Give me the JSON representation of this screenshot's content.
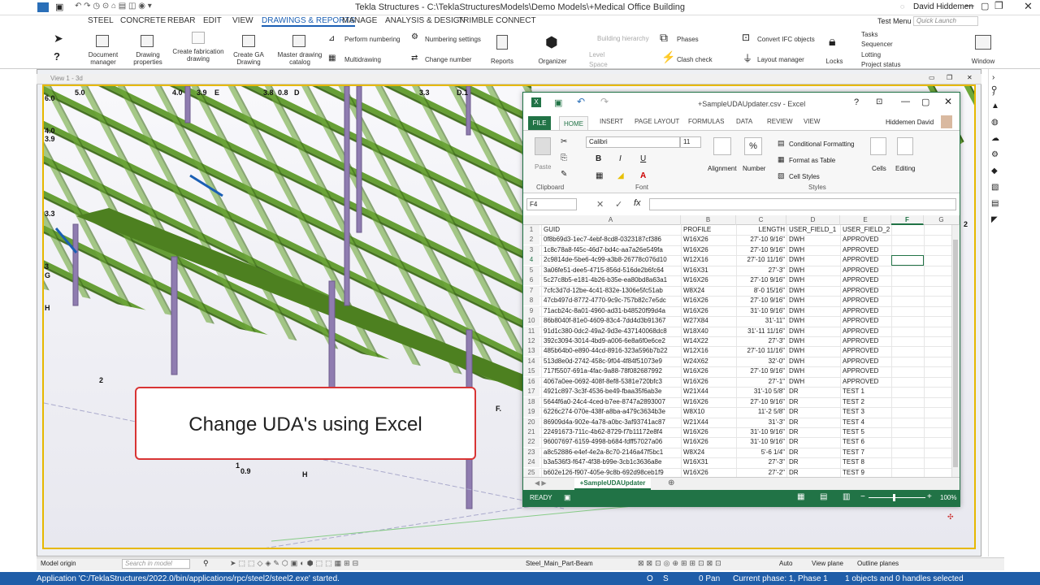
{
  "app": {
    "title": "Tekla Structures - C:\\TeklaStructuresModels\\Demo Models\\+Medical Office Building",
    "user": "David Hiddemen",
    "test_menu": "Test Menu",
    "quick_launch": "Quick Launch"
  },
  "menus": [
    "STEEL",
    "CONCRETE",
    "REBAR",
    "EDIT",
    "VIEW",
    "DRAWINGS & REPORTS",
    "MANAGE",
    "ANALYSIS & DESIGN",
    "TRIMBLE CONNECT"
  ],
  "ribbon": {
    "document_manager": "Document manager",
    "drawing_properties": "Drawing properties",
    "create_fab": "Create fabrication drawing",
    "create_ga": "Create GA Drawing",
    "master_catalog": "Master drawing catalog",
    "perform_numbering": "Perform numbering",
    "numbering_settings": "Numbering settings",
    "multidrawing": "Multidrawing",
    "change_number": "Change number",
    "reports": "Reports",
    "organizer": "Organizer",
    "building_hierarchy": "Building hierarchy",
    "level": "Level",
    "space": "Space",
    "phases": "Phases",
    "clash_check": "Clash check",
    "convert_ifc": "Convert IFC objects",
    "layout_manager": "Layout manager",
    "locks": "Locks",
    "tasks": "Tasks",
    "sequencer": "Sequencer",
    "lotting": "Lotting",
    "project_status": "Project status",
    "window": "Window"
  },
  "view": {
    "title": "View 1 - 3d"
  },
  "grid_labels": {
    "g50": "5.0",
    "g40": "4.0",
    "g39": "3.9",
    "g38": "3.8",
    "g33": "3.3",
    "gd1": "D.1",
    "gE": "E",
    "g60": "6.0",
    "g4": "4.0",
    "g3_9": "3.9",
    "g3_3": "3.3",
    "g3": "3",
    "gG": "G",
    "gH": "H",
    "g2": "2",
    "g10": "1",
    "g09": "0.9",
    "gH2": "H",
    "gF": "F.",
    "g08": "0.8",
    "gD": "D",
    "g2r": "2"
  },
  "callout": {
    "text": "Change UDA's using Excel"
  },
  "excel": {
    "title": "+SampleUDAUpdater.csv - Excel",
    "user": "Hiddemen David",
    "tabs": [
      "FILE",
      "HOME",
      "INSERT",
      "PAGE LAYOUT",
      "FORMULAS",
      "DATA",
      "REVIEW",
      "VIEW"
    ],
    "font": "Calibri",
    "font_size": "11",
    "clipboard": "Clipboard",
    "paste": "Paste",
    "font_group": "Font",
    "alignment": "Alignment",
    "number": "Number",
    "conditional": "Conditional Formatting",
    "format_table": "Format as Table",
    "cell_styles": "Cell Styles",
    "styles": "Styles",
    "cells": "Cells",
    "editing": "Editing",
    "name_box": "F4",
    "fx": "fx",
    "cols": [
      "A",
      "B",
      "C",
      "D",
      "E",
      "F",
      "G"
    ],
    "headers": [
      "GUID",
      "PROFILE",
      "LENGTH",
      "USER_FIELD_1",
      "USER_FIELD_2"
    ],
    "rows": [
      [
        "0f8b69d3-1ec7-4ebf-8cd8-0323187cf386",
        "W16X26",
        "27'-10 9/16\"",
        "DWH",
        "APPROVED"
      ],
      [
        "1c8c78a8-f45c-46d7-bd4c-aa7a26e549fa",
        "W16X26",
        "27'-10 9/16\"",
        "DWH",
        "APPROVED"
      ],
      [
        "2c9814de-5be6-4c99-a3b8-26778c076d10",
        "W12X16",
        "27'-10 11/16\"",
        "DWH",
        "APPROVED"
      ],
      [
        "3a06fe51-dee5-4715-856d-516de2b6fc64",
        "W16X31",
        "27'-3\"",
        "DWH",
        "APPROVED"
      ],
      [
        "5c27c8b5-e181-4b26-b35e-ea80bd8a63a1",
        "W16X26",
        "27'-10 9/16\"",
        "DWH",
        "APPROVED"
      ],
      [
        "7cfc3d7d-12be-4c41-832e-1306e5fc51ab",
        "W8X24",
        "8'-0 15/16\"",
        "DWH",
        "APPROVED"
      ],
      [
        "47cb497d-8772-4770-9c9c-757b82c7e5dc",
        "W16X26",
        "27'-10 9/16\"",
        "DWH",
        "APPROVED"
      ],
      [
        "71acb24c-8a01-4960-ad31-b48520f99d4a",
        "W16X26",
        "31'-10 9/16\"",
        "DWH",
        "APPROVED"
      ],
      [
        "86b8040f-81e0-4609-83c4-7dd4d3b91367",
        "W27X84",
        "31'-11\"",
        "DWH",
        "APPROVED"
      ],
      [
        "91d1c380-0dc2-49a2-9d3e-437140068dc8",
        "W18X40",
        "31'-11 11/16\"",
        "DWH",
        "APPROVED"
      ],
      [
        "392c3094-3014-4bd9-a006-6e8a6f0e6ce2",
        "W14X22",
        "27'-3\"",
        "DWH",
        "APPROVED"
      ],
      [
        "485b64b0-e890-44cd-8916-323a596b7b22",
        "W12X16",
        "27'-10 11/16\"",
        "DWH",
        "APPROVED"
      ],
      [
        "513d8e0d-2742-458c-9f04-4f84f51073e9",
        "W24X62",
        "32'-0\"",
        "DWH",
        "APPROVED"
      ],
      [
        "717f5507-691a-4fac-9a88-78f082687992",
        "W16X26",
        "27'-10 9/16\"",
        "DWH",
        "APPROVED"
      ],
      [
        "4067a0ee-0692-408f-8ef8-5381e720bfc3",
        "W16X26",
        "27'-1\"",
        "DWH",
        "APPROVED"
      ],
      [
        "4921c897-3c3f-4536-be49-fbaa35f6ab3e",
        "W21X44",
        "31'-10 5/8\"",
        "DR",
        "TEST 1"
      ],
      [
        "5644f6a0-24c4-4ced-b7ee-8747a2893007",
        "W16X26",
        "27'-10 9/16\"",
        "DR",
        "TEST 2"
      ],
      [
        "6226c274-070e-438f-a8ba-a479c3634b3e",
        "W8X10",
        "11'-2 5/8\"",
        "DR",
        "TEST 3"
      ],
      [
        "86909d4a-902e-4a78-a0bc-3af93741ac87",
        "W21X44",
        "31'-3\"",
        "DR",
        "TEST 4"
      ],
      [
        "22491673-711c-4b62-8729-f7b11172e8f4",
        "W16X26",
        "31'-10 9/16\"",
        "DR",
        "TEST 5"
      ],
      [
        "96007697-6159-4998-b684-fdff57027a06",
        "W16X26",
        "31'-10 9/16\"",
        "DR",
        "TEST 6"
      ],
      [
        "a8c52886-e4ef-4e2a-8c70-2146a47f5bc1",
        "W8X24",
        "5'-6 1/4\"",
        "DR",
        "TEST 7"
      ],
      [
        "b3a536f3-f647-4f38-b99e-3cb1c3636a8e",
        "W16X31",
        "27'-3\"",
        "DR",
        "TEST 8"
      ],
      [
        "b602e126-f907-405e-9c8b-692d98ceb1f9",
        "W16X26",
        "27'-2\"",
        "DR",
        "TEST 9"
      ]
    ],
    "sheet_tab": "+SampleUDAUpdater",
    "ready": "READY",
    "zoom": "100%"
  },
  "bottombar": {
    "model_origin": "Model origin",
    "search": "Search in model",
    "part": "Steel_Main_Part-Beam",
    "auto": "Auto",
    "view_plane": "View plane",
    "outline_planes": "Outline planes"
  },
  "status": {
    "message": "Application 'C:/TeklaStructures/2022.0/bin/applications/rpc/steel2/steel2.exe' started.",
    "o": "O",
    "s": "S",
    "pan": "0 Pan",
    "phase": "Current phase: 1, Phase 1",
    "selected": "1 objects and 0 handles selected"
  },
  "colors": {
    "steel_green": "#5a8a2a",
    "column_purple": "#8a78a8",
    "excel_green": "#217346",
    "status_blue": "#1f5da8"
  }
}
